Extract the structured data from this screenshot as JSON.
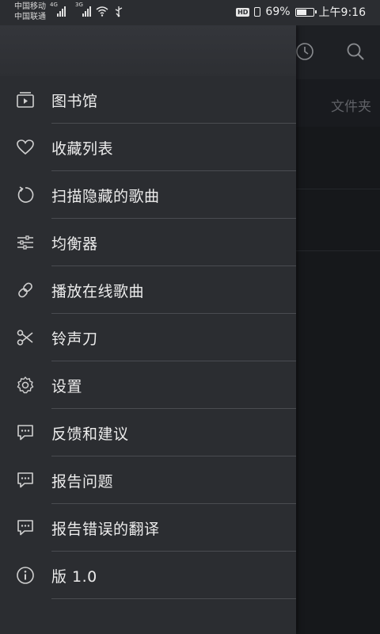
{
  "status_bar": {
    "carrier_1": "中国移动",
    "carrier_2": "中国联通",
    "network_1": "4G",
    "network_2": "3G",
    "hd_badge": "HD",
    "battery_percent_text": "69%",
    "battery_level": 0.69,
    "time": "上午9:16"
  },
  "background": {
    "tab_label": "文件夹"
  },
  "drawer": {
    "items": [
      {
        "label": "图书馆",
        "icon": "library-icon"
      },
      {
        "label": "收藏列表",
        "icon": "heart-icon"
      },
      {
        "label": "扫描隐藏的歌曲",
        "icon": "scan-refresh-icon"
      },
      {
        "label": "均衡器",
        "icon": "equalizer-icon"
      },
      {
        "label": "播放在线歌曲",
        "icon": "link-icon"
      },
      {
        "label": "铃声刀",
        "icon": "scissors-icon"
      },
      {
        "label": "设置",
        "icon": "gear-icon"
      },
      {
        "label": "反馈和建议",
        "icon": "chat-bubble-icon"
      },
      {
        "label": "报告问题",
        "icon": "chat-bubble-icon"
      },
      {
        "label": "报告错误的翻译",
        "icon": "chat-bubble-icon"
      },
      {
        "label": "版 1.0",
        "icon": "info-icon"
      }
    ]
  },
  "colors": {
    "drawer_bg": "#2b2d31",
    "text": "#ececec",
    "divider": "#4a4c51",
    "icon": "#d0d0d0"
  }
}
